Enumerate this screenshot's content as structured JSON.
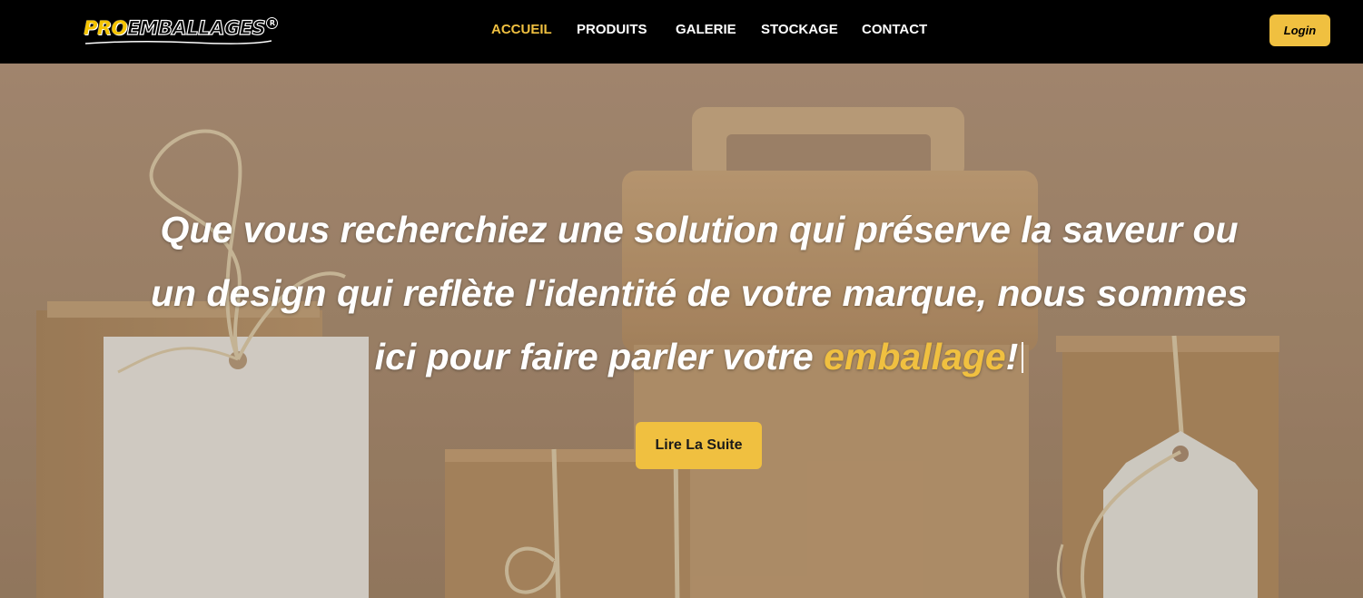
{
  "brand": {
    "pro": "PRO",
    "rest": "EMBALLAGES",
    "reg": "R"
  },
  "nav": {
    "items": [
      {
        "label": "ACCUEIL",
        "active": true
      },
      {
        "label": "PRODUITS",
        "active": false
      },
      {
        "label": "GALERIE",
        "active": false
      },
      {
        "label": "STOCKAGE",
        "active": false
      },
      {
        "label": "CONTACT",
        "active": false
      }
    ],
    "login_label": "Login"
  },
  "hero": {
    "line1": "Que vous recherchiez une solution qui préserve la saveur ou",
    "line2": "un design qui reflète l'identité de votre marque, nous sommes",
    "line3_before": "ici pour faire parler votre ",
    "line3_highlight": "emballage",
    "line3_after": "!",
    "cta_label": "Lire La Suite"
  },
  "colors": {
    "accent": "#f0c040",
    "navbar": "#000000",
    "text": "#ffffff"
  }
}
